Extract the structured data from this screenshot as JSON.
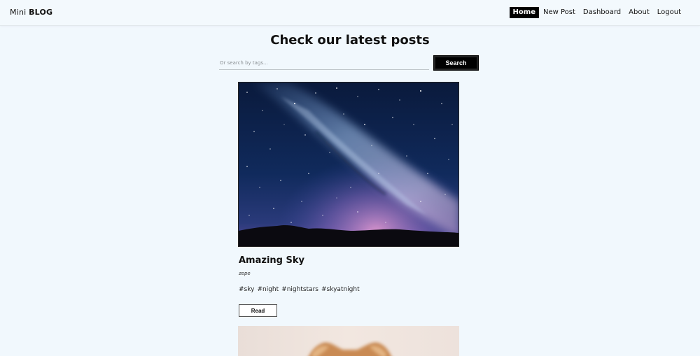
{
  "navbar": {
    "brand_light": "Mini",
    "brand_bold": "BLOG",
    "links": [
      {
        "label": "Home",
        "active": true
      },
      {
        "label": "New Post",
        "active": false
      },
      {
        "label": "Dashboard",
        "active": false
      },
      {
        "label": "About",
        "active": false
      },
      {
        "label": "Logout",
        "active": false
      }
    ]
  },
  "main": {
    "heading": "Check our latest posts",
    "search": {
      "placeholder": "Or search by tags...",
      "value": "",
      "button_label": "Search"
    }
  },
  "posts": [
    {
      "title": "Amazing Sky",
      "author": "zepe",
      "tags": [
        "#sky",
        "#night",
        "#nightstars",
        "#skyatnight"
      ],
      "read_label": "Read",
      "image": "milky-way-night-sky"
    },
    {
      "image": "orange-cat-partial"
    }
  ],
  "colors": {
    "background": "#f1f8fd",
    "accent": "#000000"
  }
}
